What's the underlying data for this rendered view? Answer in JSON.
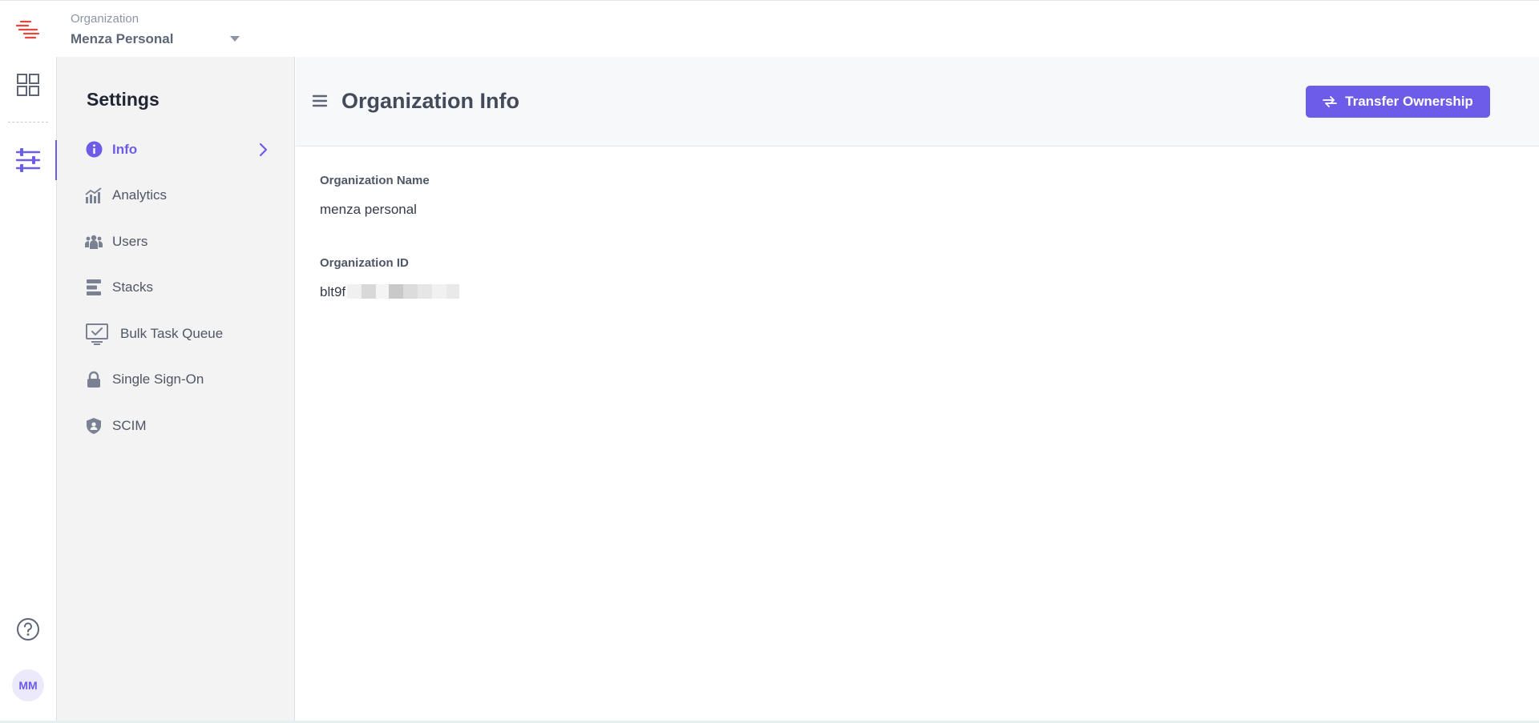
{
  "header": {
    "org_label": "Organization",
    "org_name": "Menza Personal"
  },
  "rail": {
    "avatar_initials": "MM"
  },
  "sidebar": {
    "title": "Settings",
    "items": [
      {
        "label": "Info",
        "icon": "info-icon",
        "active": true
      },
      {
        "label": "Analytics",
        "icon": "analytics-icon"
      },
      {
        "label": "Users",
        "icon": "users-icon"
      },
      {
        "label": "Stacks",
        "icon": "stacks-icon"
      },
      {
        "label": "Bulk Task Queue",
        "icon": "monitor-check-icon"
      },
      {
        "label": "Single Sign-On",
        "icon": "lock-icon"
      },
      {
        "label": "SCIM",
        "icon": "shield-user-icon"
      }
    ]
  },
  "main": {
    "title": "Organization Info",
    "transfer_button": "Transfer Ownership",
    "fields": [
      {
        "label": "Organization Name",
        "value": "menza personal"
      },
      {
        "label": "Organization ID",
        "value": "blt9f"
      }
    ]
  },
  "colors": {
    "accent": "#6c5ce7",
    "brand_logo": "#e8453c",
    "sidebar_bg": "#f3f3f3",
    "header_bg": "#f7f8fa"
  }
}
